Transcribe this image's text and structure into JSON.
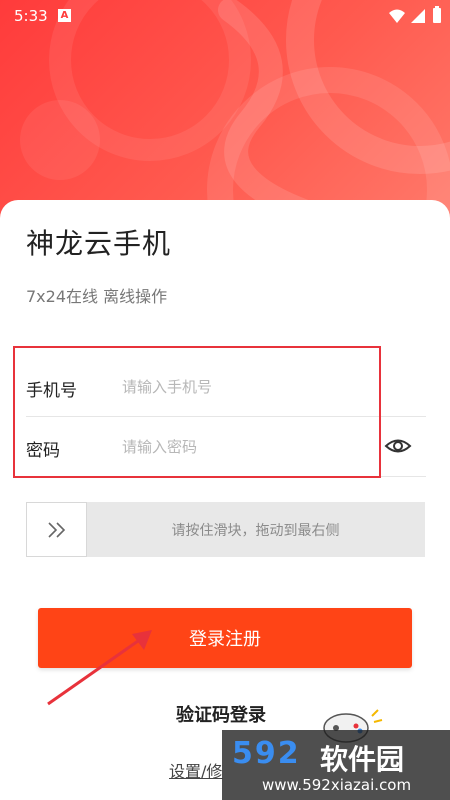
{
  "status_bar": {
    "time": "5:33",
    "notif_letter": "A"
  },
  "app": {
    "title": "神龙云手机",
    "subtitle": "7x24在线 离线操作"
  },
  "form": {
    "phone": {
      "label": "手机号",
      "placeholder": "请输入手机号",
      "value": ""
    },
    "password": {
      "label": "密码",
      "placeholder": "请输入密码",
      "value": ""
    }
  },
  "slider": {
    "handle_glyph": "»",
    "text": "请按住滑块，拖动到最右侧",
    "progress": 0
  },
  "buttons": {
    "login_register": "登录注册",
    "code_login": "验证码登录",
    "settings": "设置/修"
  },
  "watermark": {
    "logo": "592",
    "name": "软件园",
    "url": "www.592xiazai.com"
  },
  "colors": {
    "brand_red": "#ff3b3b",
    "button_orange": "#ff4416",
    "highlight_red": "#e8323b",
    "watermark_blue": "#3a8df0"
  },
  "icons": [
    "a-notification-icon",
    "wifi-icon",
    "signal-icon",
    "battery-icon",
    "eye-icon",
    "double-chevron-icon",
    "arrow-annotation-icon",
    "gamepad-icon"
  ]
}
